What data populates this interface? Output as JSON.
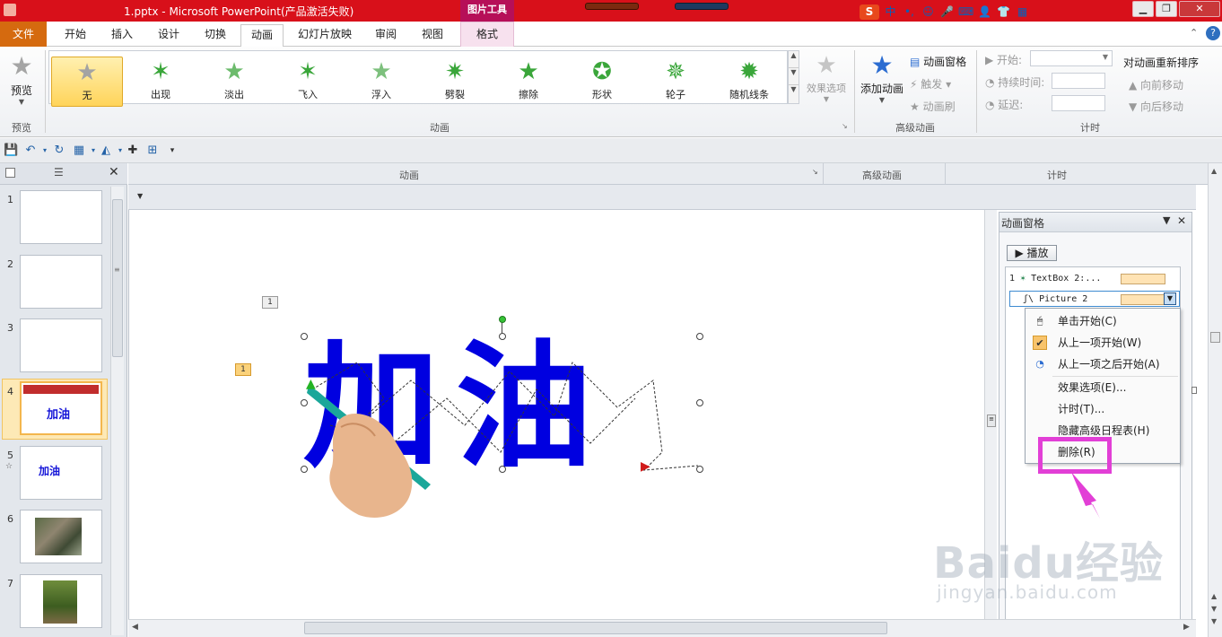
{
  "window": {
    "title": "1.pptx - Microsoft PowerPoint(产品激活失败)",
    "context_tab_group": "图片工具"
  },
  "tabs": {
    "file": "文件",
    "items": [
      "开始",
      "插入",
      "设计",
      "切换",
      "动画",
      "幻灯片放映",
      "审阅",
      "视图",
      "格式"
    ],
    "active": "动画"
  },
  "ime": {
    "logo": "S",
    "mode": "中",
    "punct": "•,"
  },
  "ribbon": {
    "preview_label": "预览",
    "preview_group": "预览",
    "animation_group": "动画",
    "animations": [
      "无",
      "出现",
      "淡出",
      "飞入",
      "浮入",
      "劈裂",
      "擦除",
      "形状",
      "轮子",
      "随机线条"
    ],
    "effect_options": "效果选项",
    "add_animation": "添加动画",
    "animation_pane": "动画窗格",
    "trigger": "触发",
    "animation_painter": "动画刷",
    "advanced_group": "高级动画",
    "start_label": "开始:",
    "duration_label": "持续时间:",
    "delay_label": "延迟:",
    "reorder_label": "对动画重新排序",
    "move_earlier": "向前移动",
    "move_later": "向后移动",
    "timing_group": "计时"
  },
  "strip": {
    "animation": "动画",
    "advanced": "高级动画",
    "timing": "计时"
  },
  "slides": {
    "numbers": [
      "1",
      "2",
      "3",
      "4",
      "5",
      "6",
      "7"
    ],
    "thumb4_text": "加油",
    "thumb5_text": "加油"
  },
  "slide": {
    "text": "加油",
    "badge_1": "1",
    "badge_2": "1"
  },
  "animation_pane": {
    "title": "动画窗格",
    "play_label": "▶ 播放",
    "items": [
      {
        "index": "1",
        "name": "TextBox 2:..."
      },
      {
        "index": "",
        "name": "Picture 2"
      }
    ]
  },
  "context_menu": {
    "items": [
      "单击开始(C)",
      "从上一项开始(W)",
      "从上一项之后开始(A)",
      "效果选项(E)...",
      "计时(T)...",
      "隐藏高级日程表(H)",
      "删除(R)"
    ],
    "checked": "从上一项开始(W)"
  },
  "watermark": {
    "main": "Baidu经验",
    "sub": "jingyan.baidu.com"
  },
  "colors": {
    "title_bar": "#d8101a",
    "file_tab": "#d56a0f",
    "text_fill": "#0000e0",
    "highlight": "#e23fd6",
    "selected_anim": "#ffd45a"
  }
}
